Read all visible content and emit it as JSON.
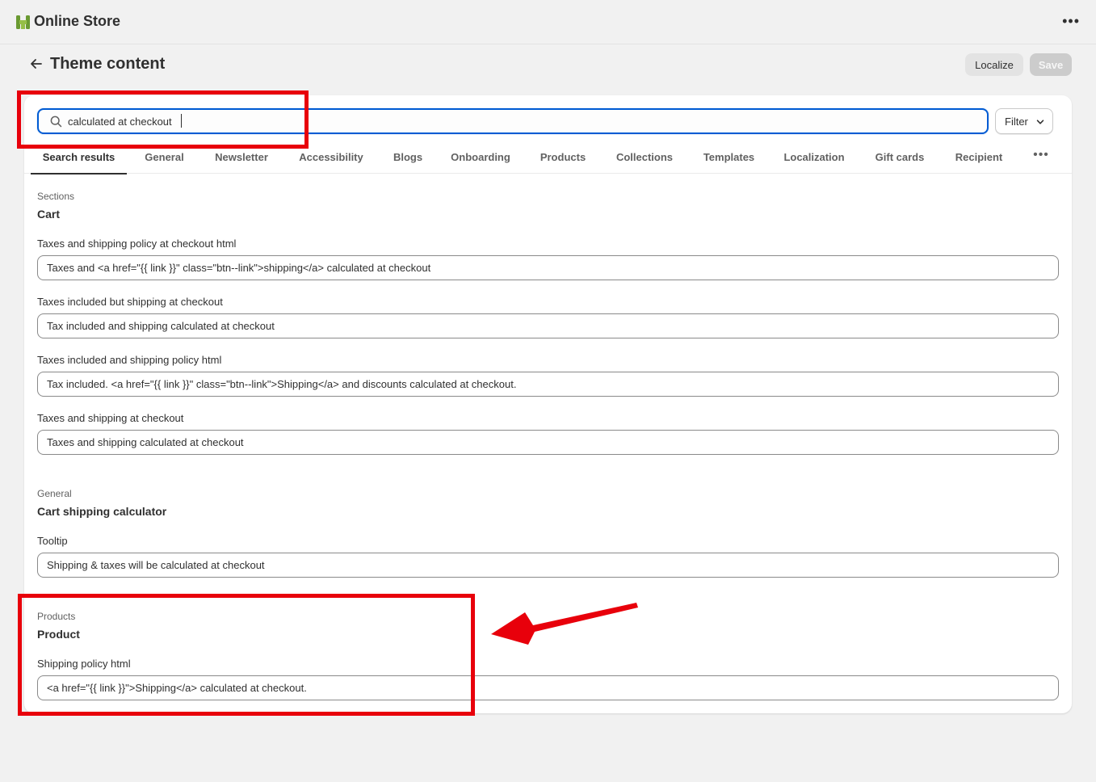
{
  "app": {
    "title": "Online Store",
    "more_icon": "ellipsis-icon"
  },
  "header": {
    "title": "Theme content",
    "localize_label": "Localize",
    "save_label": "Save"
  },
  "search": {
    "value": "calculated at checkout",
    "filter_label": "Filter"
  },
  "tabs": [
    {
      "label": "Search results",
      "active": true
    },
    {
      "label": "General"
    },
    {
      "label": "Newsletter"
    },
    {
      "label": "Accessibility"
    },
    {
      "label": "Blogs"
    },
    {
      "label": "Onboarding"
    },
    {
      "label": "Products"
    },
    {
      "label": "Collections"
    },
    {
      "label": "Templates"
    },
    {
      "label": "Localization"
    },
    {
      "label": "Gift cards"
    },
    {
      "label": "Recipient"
    }
  ],
  "groups": [
    {
      "category": "Sections",
      "title": "Cart",
      "fields": [
        {
          "label": "Taxes and shipping policy at checkout html",
          "value": "Taxes and <a href=\"{{ link }}\" class=\"btn--link\">shipping</a> calculated at checkout"
        },
        {
          "label": "Taxes included but shipping at checkout",
          "value": "Tax included and shipping calculated at checkout"
        },
        {
          "label": "Taxes included and shipping policy html",
          "value": "Tax included. <a href=\"{{ link }}\" class=\"btn--link\">Shipping</a> and discounts calculated at checkout."
        },
        {
          "label": "Taxes and shipping at checkout",
          "value": "Taxes and shipping calculated at checkout"
        }
      ]
    },
    {
      "category": "General",
      "title": "Cart shipping calculator",
      "fields": [
        {
          "label": "Tooltip",
          "value": "Shipping & taxes will be calculated at checkout"
        }
      ]
    },
    {
      "category": "Products",
      "title": "Product",
      "fields": [
        {
          "label": "Shipping policy html",
          "value": "<a href=\"{{ link }}\">Shipping</a> calculated at checkout."
        }
      ]
    }
  ],
  "colors": {
    "highlight": "#e8000b",
    "focus": "#005bd3",
    "logo": "#95bf47"
  }
}
